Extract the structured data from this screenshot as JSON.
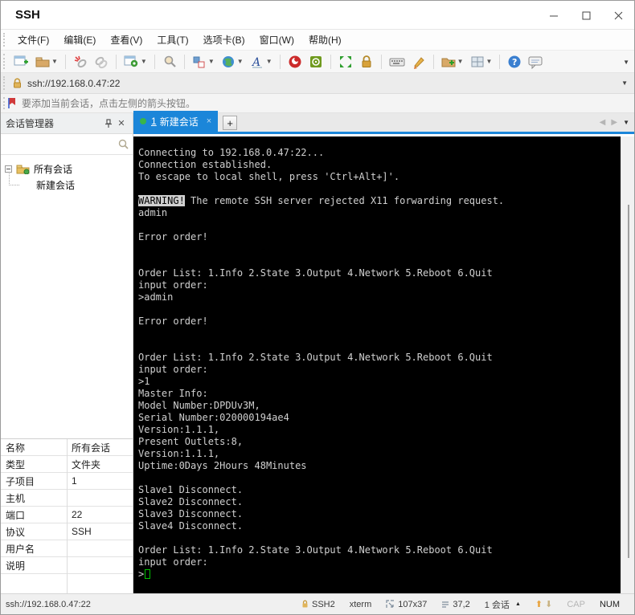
{
  "window": {
    "title": "SSH",
    "controls": [
      "minimize",
      "maximize",
      "close"
    ]
  },
  "menu": {
    "items": [
      "文件(F)",
      "编辑(E)",
      "查看(V)",
      "工具(T)",
      "选项卡(B)",
      "窗口(W)",
      "帮助(H)"
    ]
  },
  "toolbar": {
    "icons": [
      "new-session",
      "open-session",
      "disconnect",
      "reconnect",
      "session-properties",
      "find",
      "compose",
      "encoding-globe",
      "font",
      "xftp",
      "xtools",
      "fullscreen",
      "lock-screen",
      "virtual-keyboard",
      "highlight-pen",
      "new-folder",
      "layout",
      "help",
      "feedback"
    ]
  },
  "address_bar": {
    "value": "ssh://192.168.0.47:22"
  },
  "notice": {
    "text": "要添加当前会话，点击左侧的箭头按钮。"
  },
  "session_manager": {
    "title": "会话管理器",
    "search_placeholder": "",
    "tree": {
      "root": "所有会话",
      "child": "新建会话"
    }
  },
  "properties": {
    "rows": [
      {
        "label": "名称",
        "value": "所有会话"
      },
      {
        "label": "类型",
        "value": "文件夹"
      },
      {
        "label": "子项目",
        "value": "1"
      },
      {
        "label": "主机",
        "value": ""
      },
      {
        "label": "端口",
        "value": "22"
      },
      {
        "label": "协议",
        "value": "SSH"
      },
      {
        "label": "用户名",
        "value": ""
      },
      {
        "label": "说明",
        "value": ""
      }
    ]
  },
  "tabs": {
    "active_number": "1",
    "active_label": "新建会话",
    "close": "×",
    "new_tab": "+"
  },
  "terminal": {
    "highlight_token": "WARNING!",
    "lines": [
      "Connecting to 192.168.0.47:22...",
      "Connection established.",
      "To escape to local shell, press 'Ctrl+Alt+]'.",
      "",
      "WARNING! The remote SSH server rejected X11 forwarding request.",
      "admin",
      "",
      "Error order!",
      "",
      "",
      "Order List: 1.Info 2.State 3.Output 4.Network 5.Reboot 6.Quit",
      "input order:",
      ">admin",
      "",
      "Error order!",
      "",
      "",
      "Order List: 1.Info 2.State 3.Output 4.Network 5.Reboot 6.Quit",
      "input order:",
      ">1",
      "Master Info:",
      "Model Number:DPDUv3M,",
      "Serial Number:020000194ae4",
      "Version:1.1.1,",
      "Present Outlets:8,",
      "Version:1.1.1,",
      "Uptime:0Days 2Hours 48Minutes",
      "",
      "Slave1 Disconnect.",
      "Slave2 Disconnect.",
      "Slave3 Disconnect.",
      "Slave4 Disconnect.",
      "",
      "Order List: 1.Info 2.State 3.Output 4.Network 5.Reboot 6.Quit",
      "input order:"
    ],
    "prompt": ">"
  },
  "status_bar": {
    "url": "ssh://192.168.0.47:22",
    "encryption": "SSH2",
    "term_type": "xterm",
    "size": "107x37",
    "cursor_pos": "37,2",
    "session_count": "1 会话",
    "cap": "CAP",
    "num": "NUM"
  },
  "colors": {
    "accent_blue": "#1b86d9",
    "tab_dot_green": "#39b54a",
    "terminal_bg": "#000000",
    "terminal_fg": "#d0d0d0",
    "cursor_green": "#00c000",
    "lock_gold": "#d8a23a"
  }
}
